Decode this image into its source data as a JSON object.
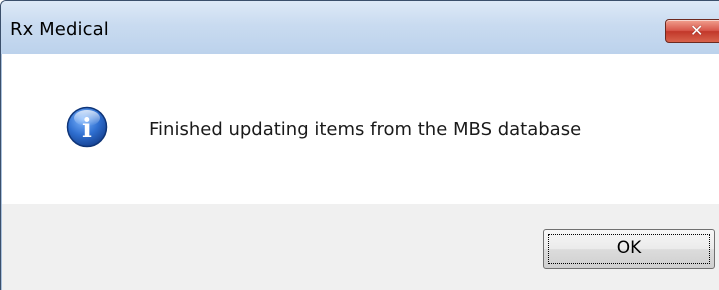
{
  "window": {
    "title": "Rx Medical",
    "close_icon": "close-icon",
    "close_glyph": "✕"
  },
  "message": {
    "icon": "info-icon",
    "icon_glyph": "i",
    "text": "Finished updating items from the MBS database"
  },
  "buttons": {
    "ok_label": "OK"
  },
  "colors": {
    "titlebar": "#c9dbf0",
    "close_button": "#c2372a",
    "info_icon": "#1f5fbf",
    "footer": "#f0f0f0"
  }
}
